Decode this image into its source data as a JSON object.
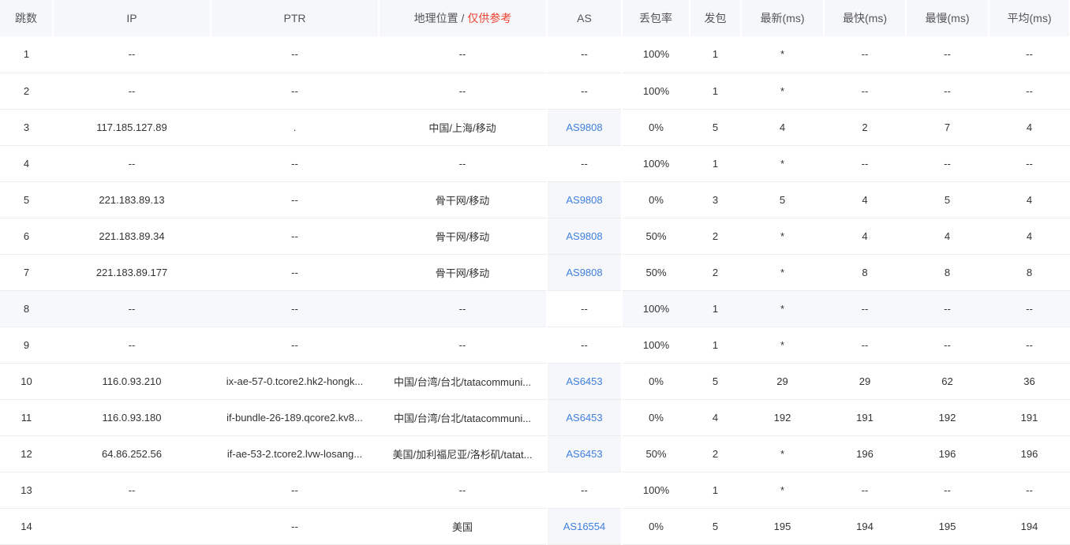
{
  "header": {
    "hop": "跳数",
    "ip": "IP",
    "ptr": "PTR",
    "geo": "地理位置",
    "geo_sep": " / ",
    "geo_note": "仅供参考",
    "as": "AS",
    "loss": "丢包率",
    "sent": "发包",
    "last": "最新(ms)",
    "best": "最快(ms)",
    "worst": "最慢(ms)",
    "avg": "平均(ms)"
  },
  "colors": {
    "accent": "#3f7fe0",
    "note": "#ee4433",
    "header_bg": "#f5f7fa"
  },
  "rows": [
    {
      "hop": "1",
      "ip": "--",
      "ptr": "--",
      "geo": "--",
      "as": "--",
      "loss": "100%",
      "sent": "1",
      "last": "*",
      "best": "--",
      "worst": "--",
      "avg": "--"
    },
    {
      "hop": "2",
      "ip": "--",
      "ptr": "--",
      "geo": "--",
      "as": "--",
      "loss": "100%",
      "sent": "1",
      "last": "*",
      "best": "--",
      "worst": "--",
      "avg": "--"
    },
    {
      "hop": "3",
      "ip": "117.185.127.89",
      "ptr": ".",
      "geo": "中国/上海/移动",
      "as": "AS9808",
      "loss": "0%",
      "sent": "5",
      "last": "4",
      "best": "2",
      "worst": "7",
      "avg": "4"
    },
    {
      "hop": "4",
      "ip": "--",
      "ptr": "--",
      "geo": "--",
      "as": "--",
      "loss": "100%",
      "sent": "1",
      "last": "*",
      "best": "--",
      "worst": "--",
      "avg": "--"
    },
    {
      "hop": "5",
      "ip": "221.183.89.13",
      "ptr": "--",
      "geo": "骨干网/移动",
      "as": "AS9808",
      "loss": "0%",
      "sent": "3",
      "last": "5",
      "best": "4",
      "worst": "5",
      "avg": "4"
    },
    {
      "hop": "6",
      "ip": "221.183.89.34",
      "ptr": "--",
      "geo": "骨干网/移动",
      "as": "AS9808",
      "loss": "50%",
      "sent": "2",
      "last": "*",
      "best": "4",
      "worst": "4",
      "avg": "4"
    },
    {
      "hop": "7",
      "ip": "221.183.89.177",
      "ptr": "--",
      "geo": "骨干网/移动",
      "as": "AS9808",
      "loss": "50%",
      "sent": "2",
      "last": "*",
      "best": "8",
      "worst": "8",
      "avg": "8"
    },
    {
      "hop": "8",
      "ip": "--",
      "ptr": "--",
      "geo": "--",
      "as": "--",
      "loss": "100%",
      "sent": "1",
      "last": "*",
      "best": "--",
      "worst": "--",
      "avg": "--",
      "highlight": true
    },
    {
      "hop": "9",
      "ip": "--",
      "ptr": "--",
      "geo": "--",
      "as": "--",
      "loss": "100%",
      "sent": "1",
      "last": "*",
      "best": "--",
      "worst": "--",
      "avg": "--"
    },
    {
      "hop": "10",
      "ip": "116.0.93.210",
      "ptr": "ix-ae-57-0.tcore2.hk2-hongk...",
      "geo": "中国/台湾/台北/tatacommuni...",
      "as": "AS6453",
      "loss": "0%",
      "sent": "5",
      "last": "29",
      "best": "29",
      "worst": "62",
      "avg": "36"
    },
    {
      "hop": "11",
      "ip": "116.0.93.180",
      "ptr": "if-bundle-26-189.qcore2.kv8...",
      "geo": "中国/台湾/台北/tatacommuni...",
      "as": "AS6453",
      "loss": "0%",
      "sent": "4",
      "last": "192",
      "best": "191",
      "worst": "192",
      "avg": "191"
    },
    {
      "hop": "12",
      "ip": "64.86.252.56",
      "ptr": "if-ae-53-2.tcore2.lvw-losang...",
      "geo": "美国/加利福尼亚/洛杉矶/tatat...",
      "as": "AS6453",
      "loss": "50%",
      "sent": "2",
      "last": "*",
      "best": "196",
      "worst": "196",
      "avg": "196"
    },
    {
      "hop": "13",
      "ip": "--",
      "ptr": "--",
      "geo": "--",
      "as": "--",
      "loss": "100%",
      "sent": "1",
      "last": "*",
      "best": "--",
      "worst": "--",
      "avg": "--"
    },
    {
      "hop": "14",
      "ip": "",
      "ptr": "--",
      "geo": "美国",
      "as": "AS16554",
      "loss": "0%",
      "sent": "5",
      "last": "195",
      "best": "194",
      "worst": "195",
      "avg": "194"
    }
  ]
}
